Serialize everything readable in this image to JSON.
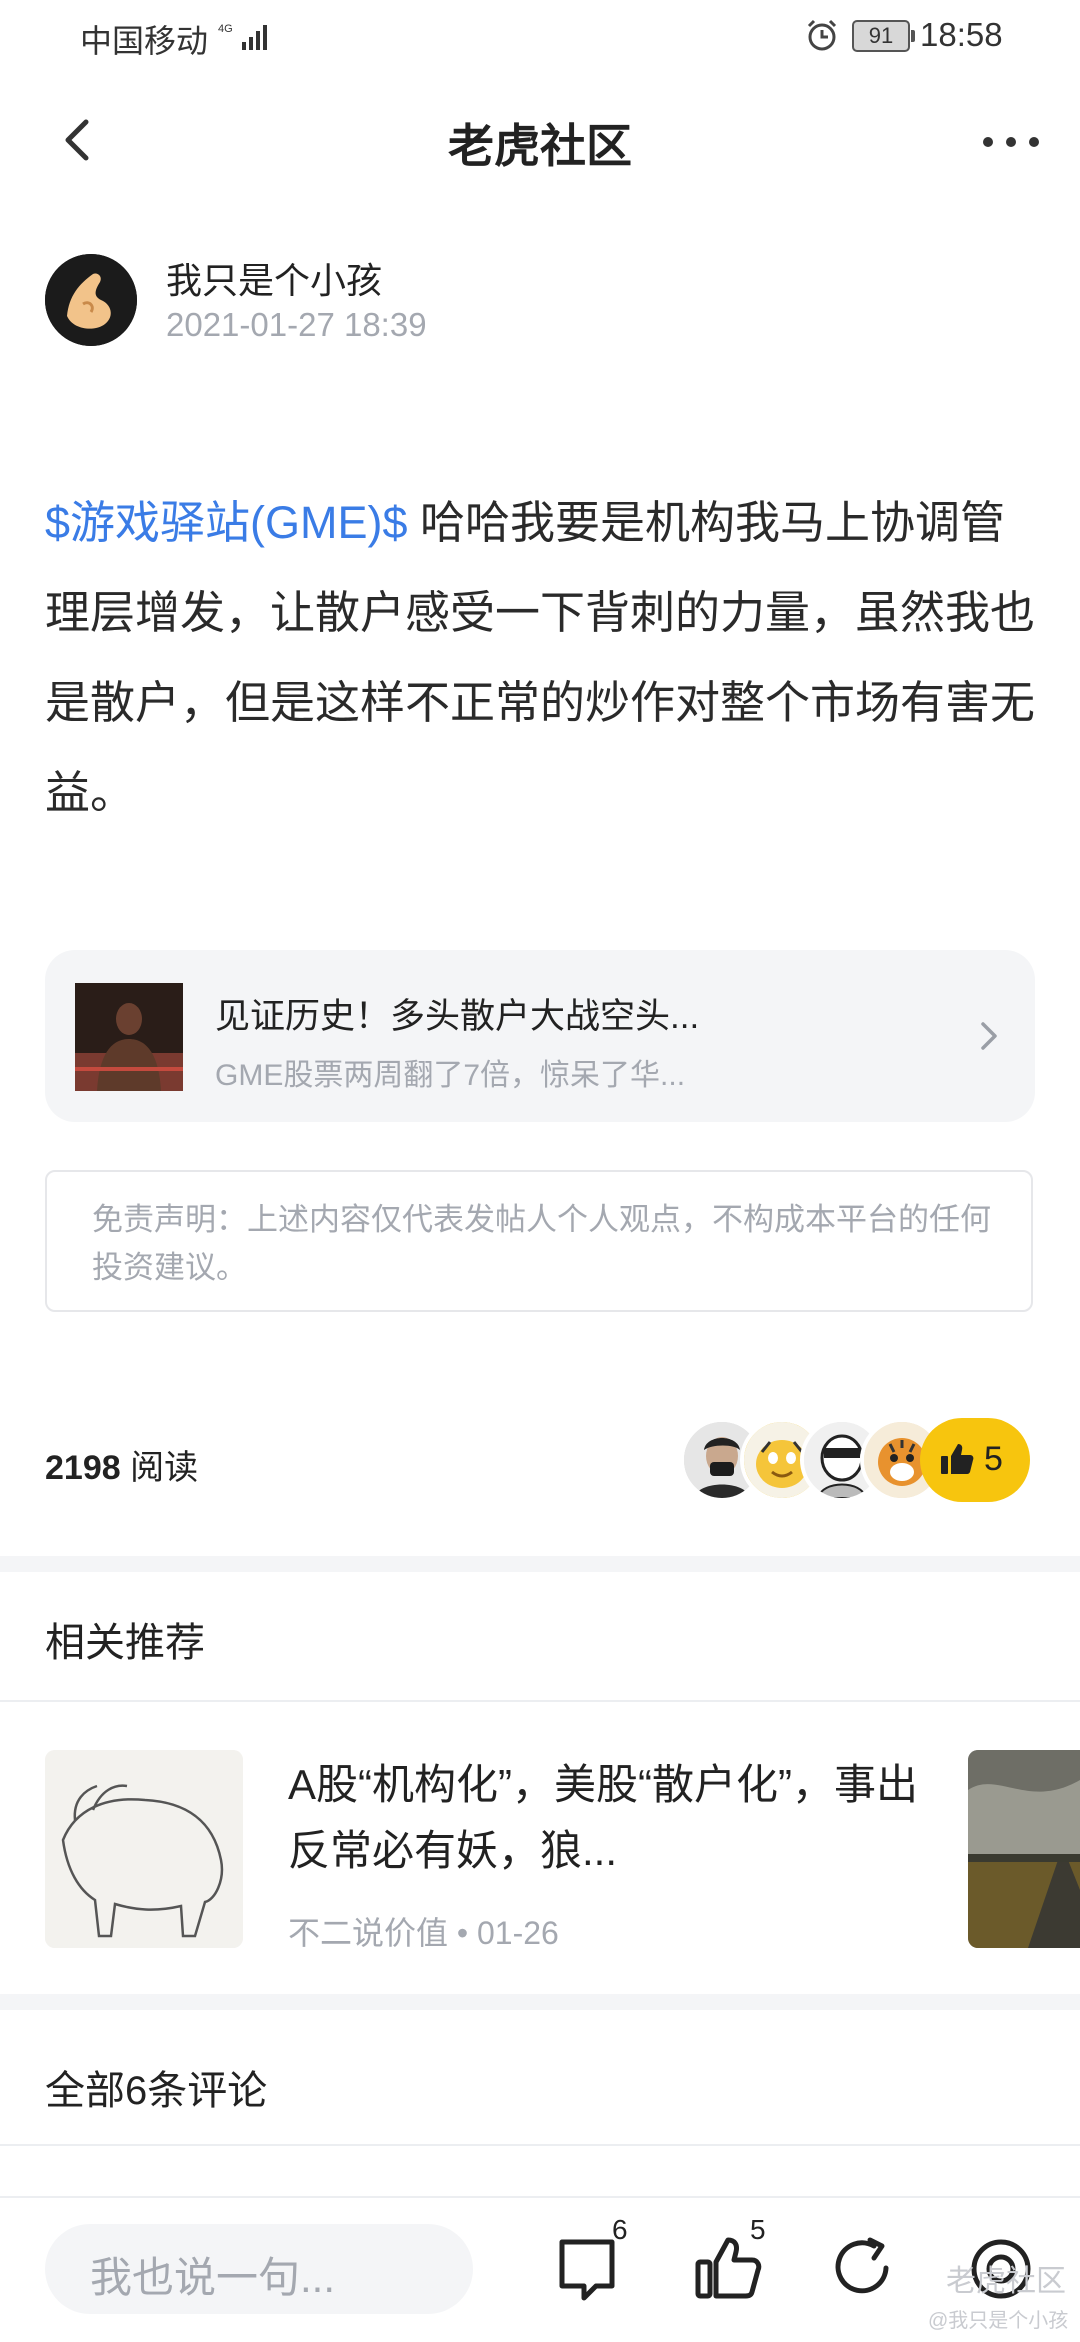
{
  "status_bar": {
    "carrier": "中国移动",
    "network": "4G",
    "battery": "91",
    "time": "18:58"
  },
  "nav": {
    "title": "老虎社区"
  },
  "author": {
    "name": "我只是个小孩",
    "time": "2021-01-27 18:39"
  },
  "post": {
    "ticker": "$游戏驿站(GME)$",
    "text": " 哈哈我要是机构我马上协调管理层增发，让散户感受一下背刺的力量，虽然我也是散户，但是这样不正常的炒作对整个市场有害无益。"
  },
  "link_card": {
    "title": "见证历史！多头散户大战空头...",
    "subtitle": "GME股票两周翻了7倍，惊呆了华..."
  },
  "disclaimer": "免责声明：上述内容仅代表发帖人个人观点，不构成本平台的任何投资建议。",
  "stats": {
    "reads_count": "2198",
    "reads_label": "阅读",
    "likes": "5"
  },
  "related": {
    "title": "相关推荐",
    "items": [
      {
        "title": "A股“机构化”，美股“散户化”，事出反常必有妖，狼...",
        "source": "不二说价值",
        "date": "01-26"
      }
    ]
  },
  "comments": {
    "title": "全部6条评论"
  },
  "bottom_bar": {
    "input_placeholder": "我也说一句...",
    "comment_count": "6",
    "like_count": "5",
    "watermark": "老虎社区",
    "watermark_user": "@我只是个小孩"
  },
  "colors": {
    "accent": "#3a7ce6",
    "like": "#f7c50e",
    "muted": "#a4a8b0"
  },
  "icons": [
    "back-arrow-icon",
    "more-icon",
    "chevron-right-icon",
    "thumbs-up-icon",
    "comment-icon",
    "share-icon",
    "favorite-icon",
    "alarm-icon",
    "signal-icon"
  ]
}
